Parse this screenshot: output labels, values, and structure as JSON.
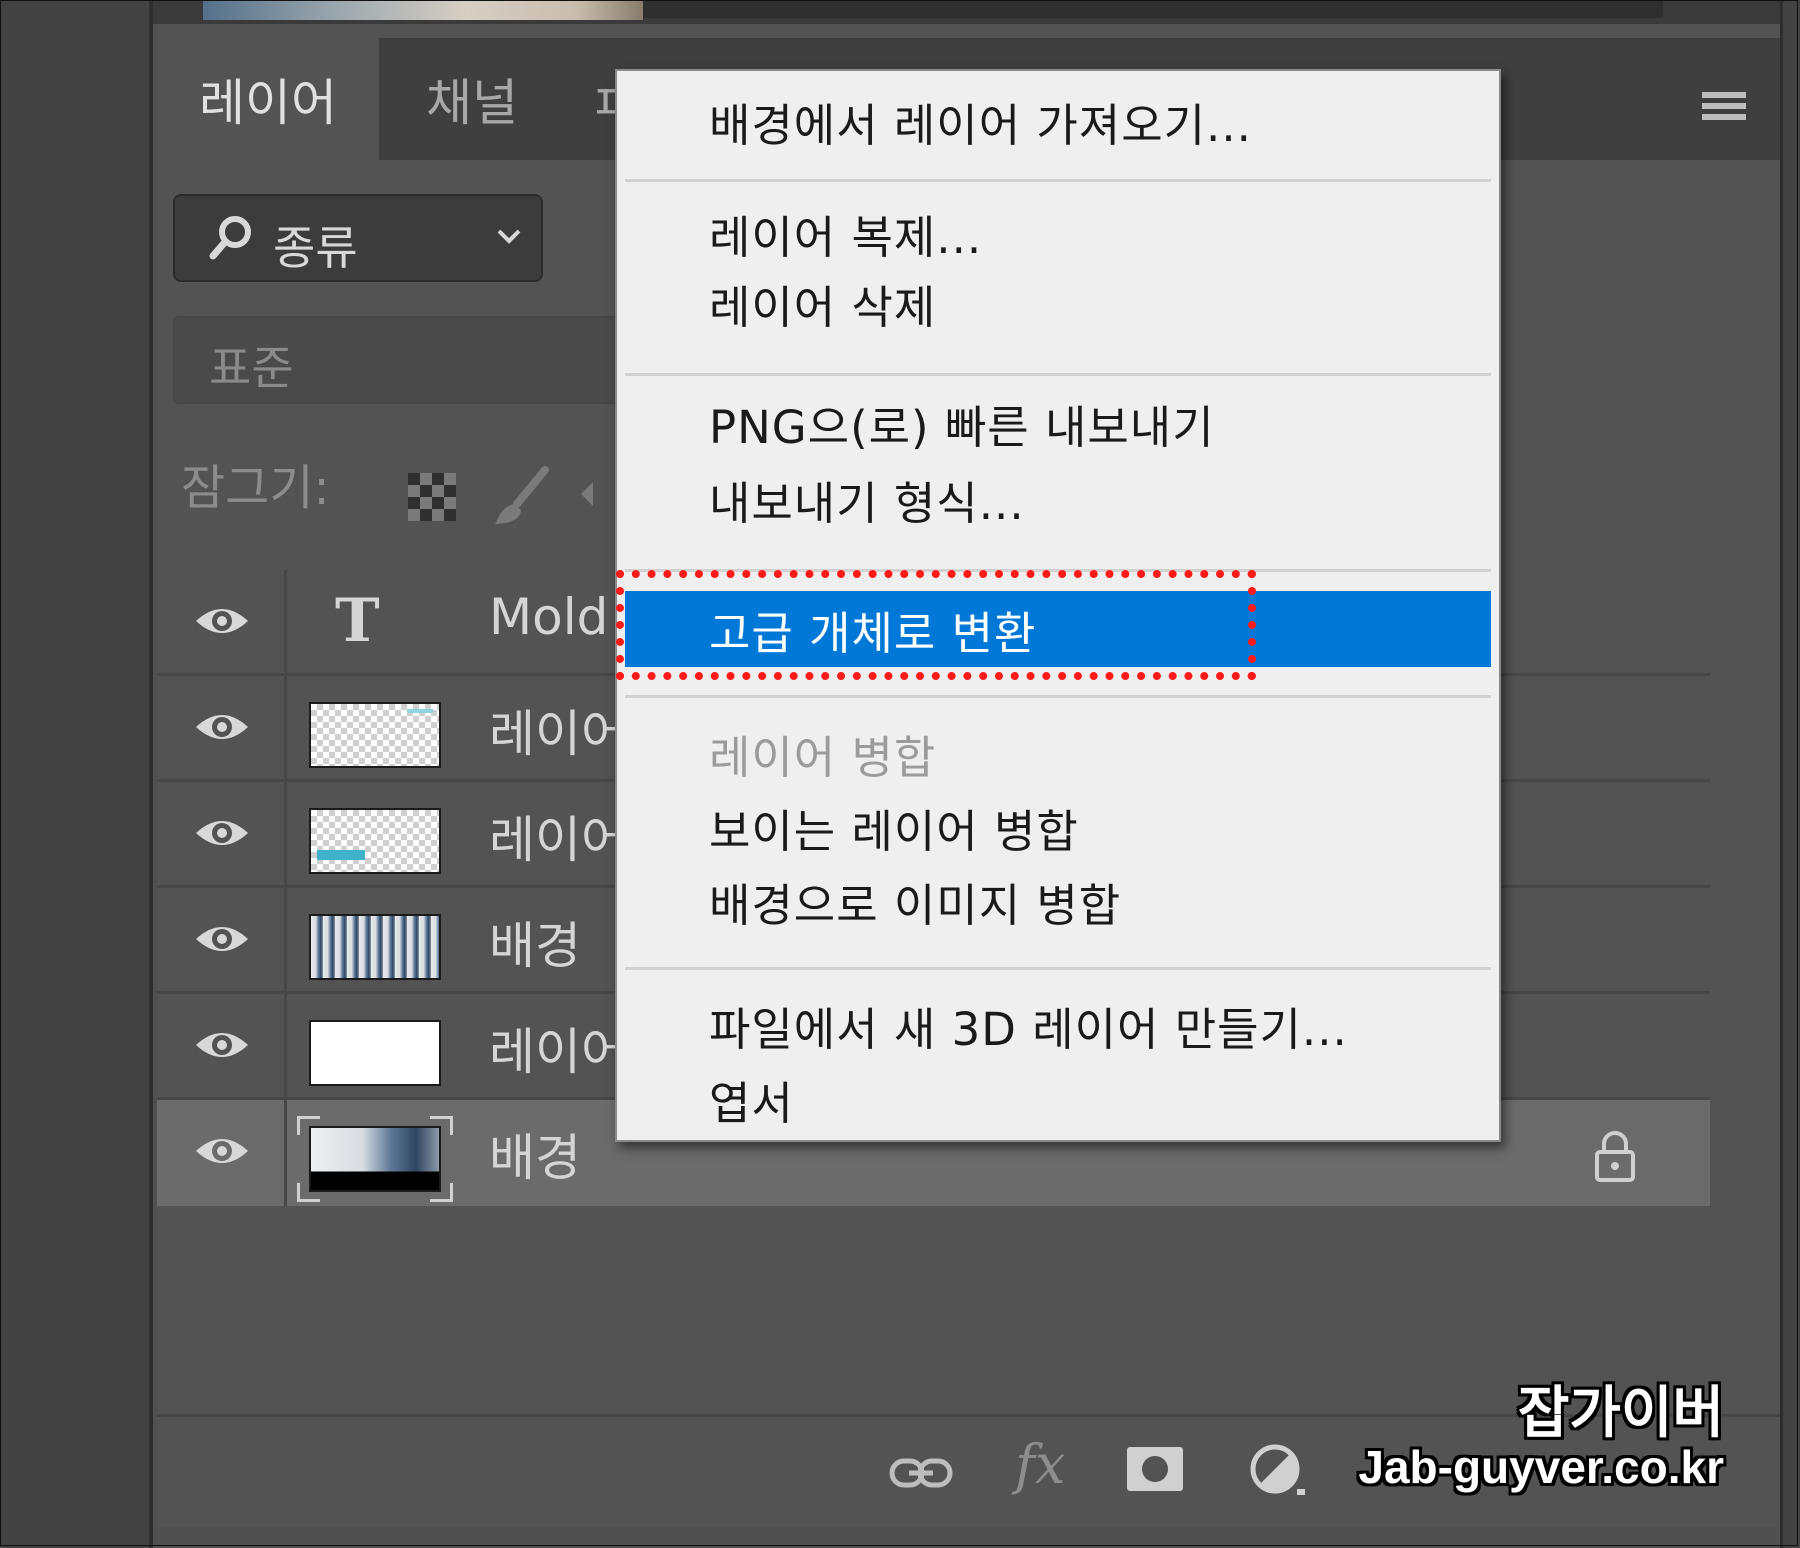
{
  "tabs": [
    {
      "label": "레이어",
      "active": true
    },
    {
      "label": "채널",
      "active": false
    },
    {
      "label": "ㅍ",
      "active": false
    }
  ],
  "filter": {
    "icon": "search-icon",
    "label": "종류",
    "chevron": "chevron-down-icon"
  },
  "blend_mode": {
    "value": "표준"
  },
  "lock": {
    "label": "잠그기:"
  },
  "layers": [
    {
      "type": "text",
      "name": "Mold",
      "visible": true
    },
    {
      "type": "pixel",
      "name": "레이어",
      "visible": true,
      "thumb": "transparent"
    },
    {
      "type": "pixel",
      "name": "레이어",
      "visible": true,
      "thumb": "transparent-cyan"
    },
    {
      "type": "pixel",
      "name": "배경",
      "visible": true,
      "thumb": "photo"
    },
    {
      "type": "pixel",
      "name": "레이어",
      "visible": true,
      "thumb": "white"
    },
    {
      "type": "background",
      "name": "배경",
      "visible": true,
      "thumb": "photo",
      "locked": true,
      "selected": true
    }
  ],
  "context_menu": {
    "groups": [
      [
        {
          "label": "배경에서 레이어 가져오기...",
          "enabled": true
        }
      ],
      [
        {
          "label": "레이어 복제...",
          "enabled": true
        },
        {
          "label": "레이어 삭제",
          "enabled": true
        }
      ],
      [
        {
          "label": "PNG으(로) 빠른 내보내기",
          "enabled": true
        },
        {
          "label": "내보내기 형식...",
          "enabled": true
        }
      ],
      [
        {
          "label": "고급 개체로 변환",
          "enabled": true,
          "highlighted": true
        }
      ],
      [
        {
          "label": "레이어 병합",
          "enabled": false
        },
        {
          "label": "보이는 레이어 병합",
          "enabled": true
        },
        {
          "label": "배경으로 이미지 병합",
          "enabled": true
        }
      ],
      [
        {
          "label": "파일에서 새 3D 레이어 만들기...",
          "enabled": true
        },
        {
          "label": "엽서",
          "enabled": true
        }
      ]
    ]
  },
  "bottom_icons": [
    "link-icon",
    "fx-icon",
    "mask-icon",
    "adjustment-icon"
  ],
  "fx_label": "fx",
  "watermark": {
    "line1": "잡가이버",
    "line2": "Jab-guyver.co.kr"
  },
  "colors": {
    "highlight": "#0078d7",
    "annotation": "#ff1a1a",
    "panel": "#535353"
  }
}
